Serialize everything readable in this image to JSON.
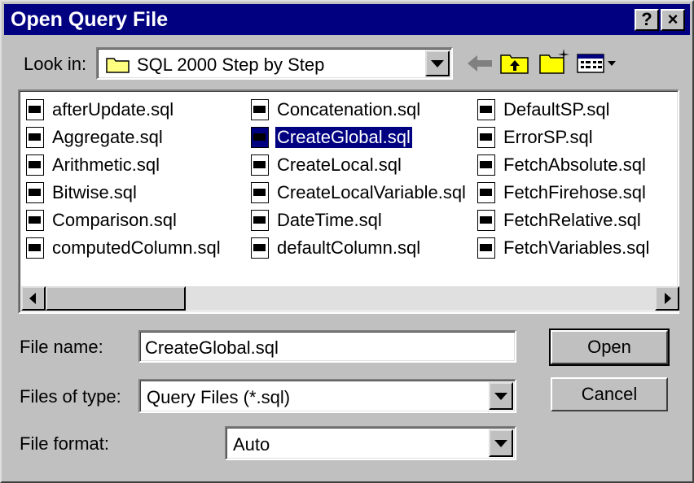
{
  "window": {
    "title": "Open Query File",
    "help_label": "?",
    "close_label": "×"
  },
  "look_in": {
    "label": "Look in:",
    "value": "SQL 2000 Step by Step"
  },
  "toolbar": {
    "icons": [
      "back-arrow-icon",
      "up-one-level-icon",
      "new-folder-icon",
      "view-menu-icon"
    ]
  },
  "files": [
    {
      "name": "afterUpdate.sql"
    },
    {
      "name": "Aggregate.sql"
    },
    {
      "name": "Arithmetic.sql"
    },
    {
      "name": "Bitwise.sql"
    },
    {
      "name": "Comparison.sql"
    },
    {
      "name": "computedColumn.sql"
    },
    {
      "name": "Concatenation.sql"
    },
    {
      "name": "CreateGlobal.sql",
      "selected": true
    },
    {
      "name": "CreateLocal.sql"
    },
    {
      "name": "CreateLocalVariable.sql"
    },
    {
      "name": "DateTime.sql"
    },
    {
      "name": "defaultColumn.sql"
    },
    {
      "name": "DefaultSP.sql"
    },
    {
      "name": "ErrorSP.sql"
    },
    {
      "name": "FetchAbsolute.sql"
    },
    {
      "name": "FetchFirehose.sql"
    },
    {
      "name": "FetchRelative.sql"
    },
    {
      "name": "FetchVariables.sql"
    }
  ],
  "file_name": {
    "label": "File name:",
    "value": "CreateGlobal.sql"
  },
  "files_of_type": {
    "label": "Files of type:",
    "value": "Query Files (*.sql)"
  },
  "file_format": {
    "label": "File format:",
    "value": "Auto"
  },
  "buttons": {
    "open": "Open",
    "cancel": "Cancel"
  },
  "colors": {
    "title_bar": "#000080",
    "face": "#c0c0c0",
    "selection": "#000080"
  }
}
